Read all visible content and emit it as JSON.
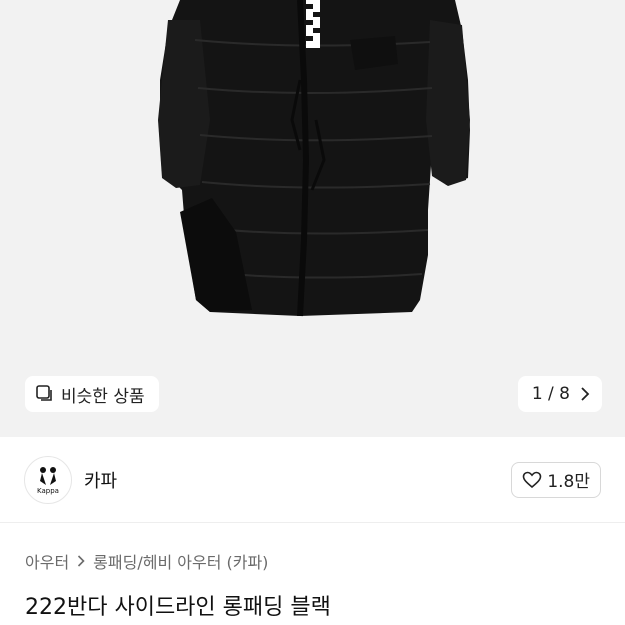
{
  "gallery": {
    "similar_label": "비슷한 상품",
    "page_indicator": "1 / 8",
    "similar_icon": "copy-icon",
    "next_icon": "chevron-right-icon"
  },
  "seller": {
    "name": "카파",
    "logo_text": "Kappa",
    "like_count": "1.8만",
    "like_icon": "heart-icon"
  },
  "breadcrumb": {
    "category": "아우터",
    "subcategory": "롱패딩/헤비 아우터 (카파)"
  },
  "product": {
    "title": "222반다 사이드라인 롱패딩 블랙"
  },
  "colors": {
    "hero_bg": "#f2f2f2",
    "jacket": "#141414"
  }
}
